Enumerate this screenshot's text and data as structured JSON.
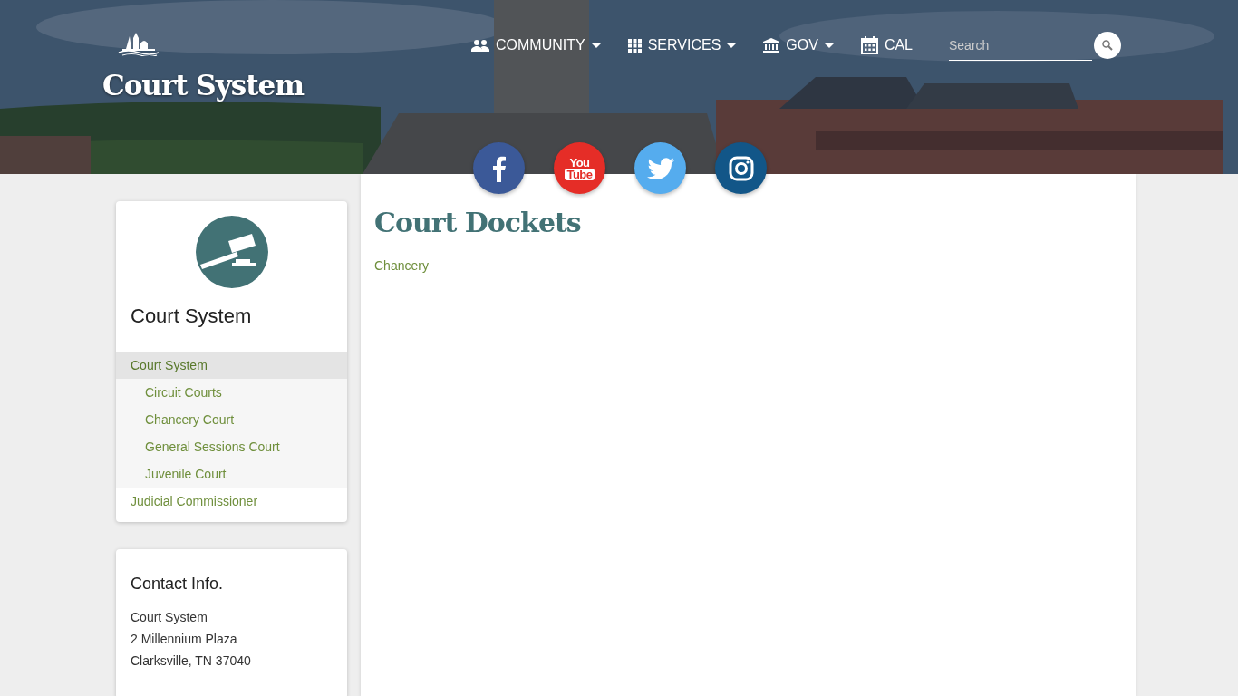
{
  "header": {
    "title": "Court System",
    "nav": [
      {
        "kind": "people",
        "label": "COMMUNITY",
        "dropdown": true
      },
      {
        "kind": "grid",
        "label": "SERVICES",
        "dropdown": true
      },
      {
        "kind": "bank",
        "label": "GOV",
        "dropdown": true
      },
      {
        "kind": "calendar",
        "label": "CAL",
        "dropdown": false
      }
    ],
    "search": {
      "placeholder": "Search"
    }
  },
  "social": [
    {
      "kind": "facebook"
    },
    {
      "kind": "youtube",
      "top": "You",
      "bottom": "Tube"
    },
    {
      "kind": "twitter"
    },
    {
      "kind": "instagram"
    }
  ],
  "sidebar": {
    "title": "Court System",
    "items": [
      {
        "label": "Court System",
        "selected": true,
        "children": [
          {
            "label": "Circuit Courts",
            "selected": false
          },
          {
            "label": "Chancery Court",
            "selected": false
          },
          {
            "label": "General Sessions Court",
            "selected": false
          },
          {
            "label": "Juvenile Court",
            "selected": false
          }
        ]
      },
      {
        "label": "Judicial Commissioner",
        "selected": false
      }
    ]
  },
  "contact": {
    "title": "Contact Info.",
    "lines": [
      "Court System",
      "2 Millennium Plaza",
      "Clarksville, TN 37040"
    ]
  },
  "main": {
    "title": "Court Dockets",
    "links": [
      "Chancery"
    ]
  }
}
